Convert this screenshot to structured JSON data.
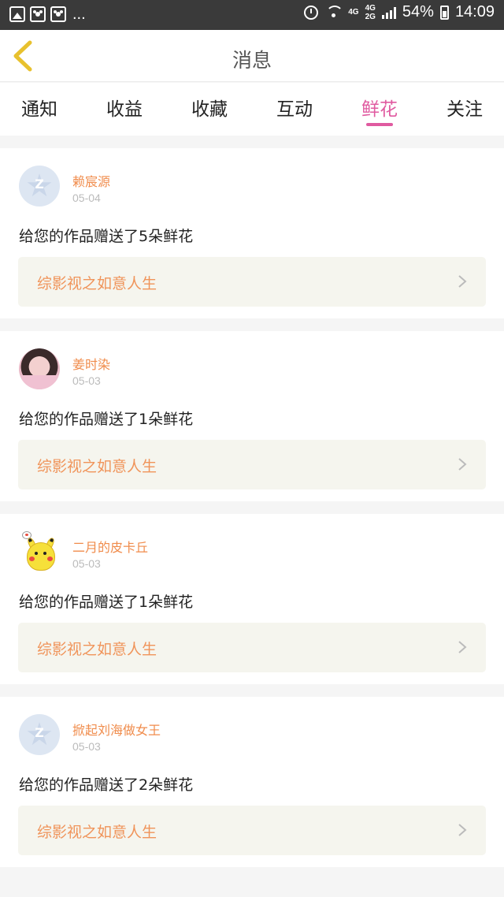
{
  "status_bar": {
    "dots": "...",
    "network_top": "4G",
    "network_mid": "4G",
    "network_bottom": "2G",
    "battery": "54%",
    "time": "14:09"
  },
  "header": {
    "title": "消息"
  },
  "tabs": [
    {
      "label": "通知",
      "active": false
    },
    {
      "label": "收益",
      "active": false
    },
    {
      "label": "收藏",
      "active": false
    },
    {
      "label": "互动",
      "active": false
    },
    {
      "label": "鲜花",
      "active": true
    },
    {
      "label": "关注",
      "active": false
    }
  ],
  "messages": [
    {
      "user": "赖宸源",
      "date": "05-04",
      "text": "给您的作品赠送了5朵鲜花",
      "work": "综影视之如意人生",
      "avatar": "default"
    },
    {
      "user": "姜时染",
      "date": "05-03",
      "text": "给您的作品赠送了1朵鲜花",
      "work": "综影视之如意人生",
      "avatar": "photo"
    },
    {
      "user": "二月的皮卡丘",
      "date": "05-03",
      "text": "给您的作品赠送了1朵鲜花",
      "work": "综影视之如意人生",
      "avatar": "pikachu"
    },
    {
      "user": "掀起刘海做女王",
      "date": "05-03",
      "text": "给您的作品赠送了2朵鲜花",
      "work": "综影视之如意人生",
      "avatar": "default"
    }
  ],
  "colors": {
    "accent": "#e05aa0",
    "username": "#f08c4c",
    "work_title": "#f0945a",
    "back_icon": "#e8c12e"
  }
}
